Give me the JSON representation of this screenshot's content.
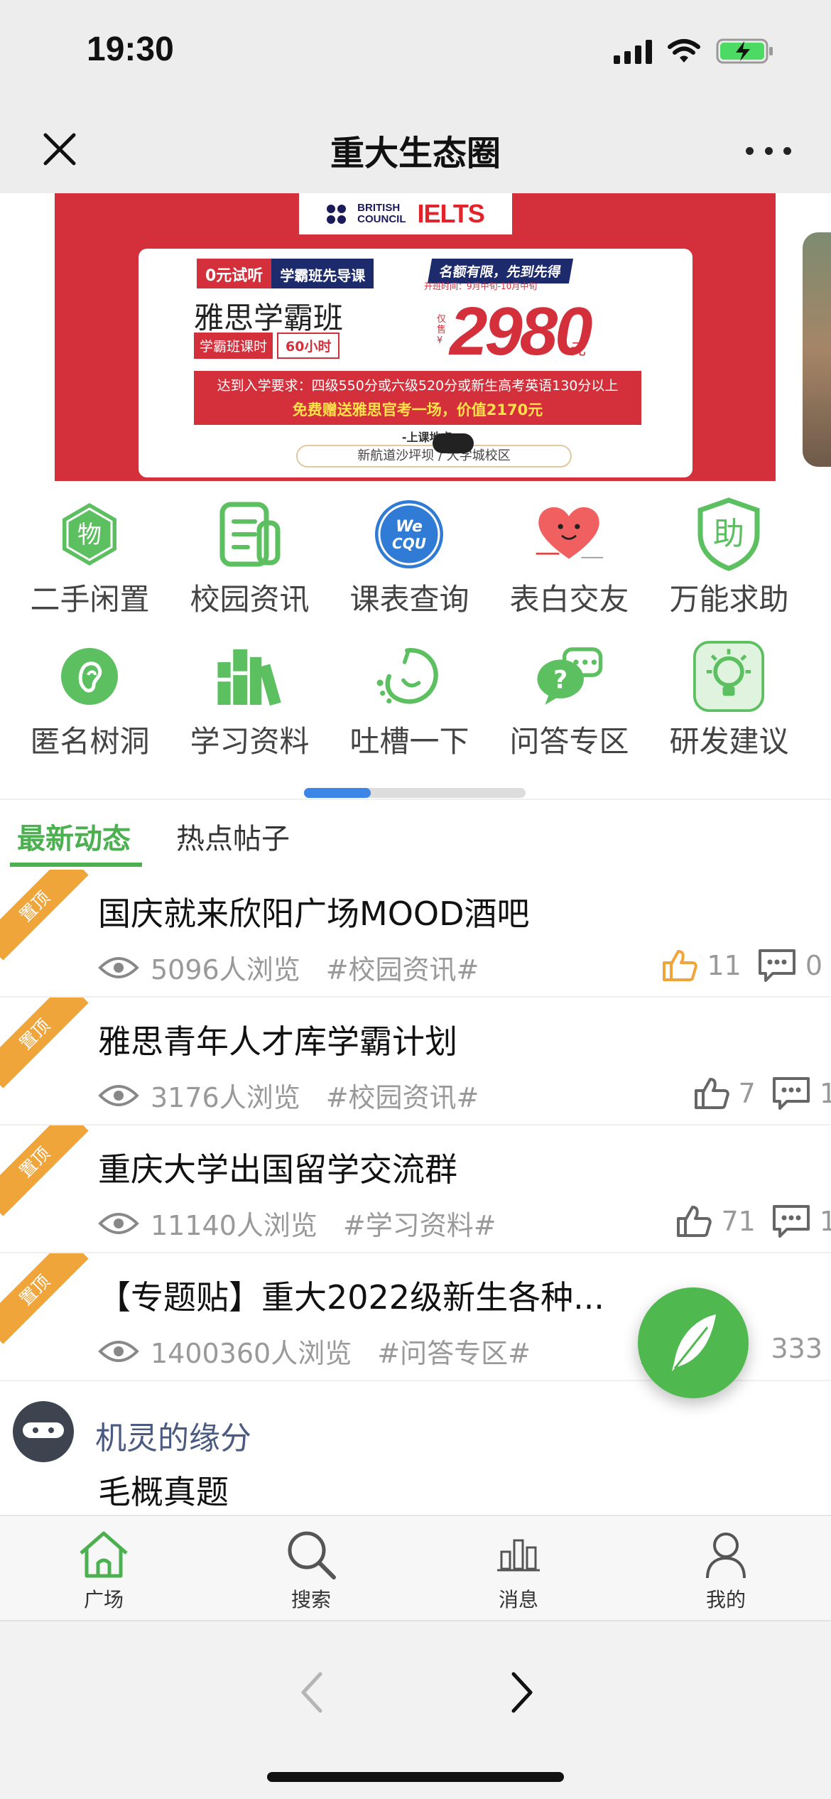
{
  "status": {
    "time": "19:30"
  },
  "nav": {
    "title": "重大生态圈"
  },
  "banner": {
    "brand_top": "BRITISH",
    "brand_bottom": "COUNCIL",
    "ielts": "IELTS",
    "tag_free": "0元试听",
    "tag_course": "学霸班先导课",
    "tag_limited": "名额有限，先到先得",
    "tag_date": "开班时间：9月中旬-10月中旬",
    "course_title": "雅思学霸班",
    "hours_label": "学霸班课时",
    "hours_value": "60小时",
    "price_prefix": "仅售¥",
    "price": "2980",
    "price_unit": "元",
    "requirement": "达到入学要求：四级550分或六级520分或新生高考英语130分以上",
    "gift": "免费赠送雅思官考一场，价值2170元",
    "place_label": "-上课地点-",
    "place": "新航道沙坪坝 / 大学城校区"
  },
  "categories": [
    {
      "label": "二手闲置",
      "icon": "goods-icon",
      "glyph": "物"
    },
    {
      "label": "校园资讯",
      "icon": "news-icon"
    },
    {
      "label": "课表查询",
      "icon": "wecqu-icon",
      "glyph": "We CQU"
    },
    {
      "label": "表白交友",
      "icon": "heart-icon"
    },
    {
      "label": "万能求助",
      "icon": "help-shield-icon",
      "glyph": "助"
    },
    {
      "label": "匿名树洞",
      "icon": "ear-icon"
    },
    {
      "label": "学习资料",
      "icon": "books-icon"
    },
    {
      "label": "吐槽一下",
      "icon": "complain-icon"
    },
    {
      "label": "问答专区",
      "icon": "qa-icon",
      "glyph": "?"
    },
    {
      "label": "研发建议",
      "icon": "bulb-icon"
    }
  ],
  "feed_tabs": {
    "latest": "最新动态",
    "hot": "热点帖子"
  },
  "pinned_label": "置顶",
  "posts": [
    {
      "title": "国庆就来欣阳广场MOOD酒吧",
      "views": "5096人浏览",
      "tag": "#校园资讯#",
      "likes": "11",
      "comments": "0",
      "liked": true
    },
    {
      "title": "雅思青年人才库学霸计划",
      "views": "3176人浏览",
      "tag": "#校园资讯#",
      "likes": "7",
      "comments": "1",
      "liked": false
    },
    {
      "title": "重庆大学出国留学交流群",
      "views": "11140人浏览",
      "tag": "#学习资料#",
      "likes": "71",
      "comments": "1",
      "liked": false
    },
    {
      "title": "【专题贴】重大2022级新生各种...",
      "views": "1400360人浏览",
      "tag": "#问答专区#",
      "likes": "",
      "comments": "333",
      "liked": false
    }
  ],
  "user_post": {
    "name": "机灵的缘分",
    "title": "毛概真题"
  },
  "tab_bar": [
    {
      "label": "广场",
      "icon": "home-icon"
    },
    {
      "label": "搜索",
      "icon": "search-icon"
    },
    {
      "label": "消息",
      "icon": "message-icon"
    },
    {
      "label": "我的",
      "icon": "profile-icon"
    }
  ],
  "colors": {
    "accent": "#4caf50",
    "banner_red": "#d3303c",
    "ribbon": "#f0a53a",
    "fab": "#4fb84f"
  }
}
